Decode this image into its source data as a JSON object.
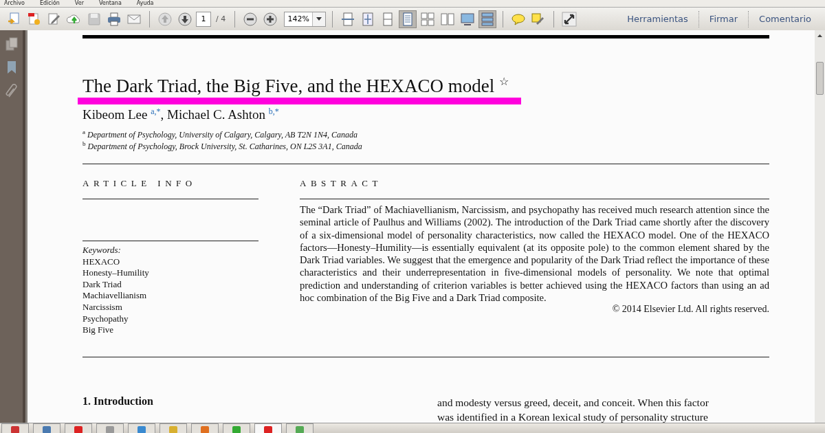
{
  "menu": [
    "Archivo",
    "Edición",
    "Ver",
    "Ventana",
    "Ayuda"
  ],
  "toolbar": {
    "page_field": "1",
    "page_total": "/ 4",
    "zoom": "142%",
    "view_buttons": [
      {
        "selected": false
      },
      {
        "selected": false
      },
      {
        "selected": false
      },
      {
        "selected": true
      },
      {
        "selected": false
      },
      {
        "selected": false
      },
      {
        "selected": false
      },
      {
        "selected": true
      }
    ],
    "panels": [
      "Herramientas",
      "Firmar",
      "Comentario"
    ]
  },
  "document": {
    "title": "The Dark Triad, the Big Five, and the HEXACO model $^{☆}$",
    "authors": "Kibeom Lee $^{a,*}$, Michael C. Ashton $^{b,*}$",
    "affiliations": [
      "$^{a}$ Department of Psychology, University of Calgary, Calgary, AB T2N 1N4, Canada",
      "$^{b}$ Department of Psychology, Brock University, St. Catharines, ON L2S 3A1, Canada"
    ],
    "article_info_heading": "ARTICLE INFO",
    "keywords_label": "Keywords:",
    "keywords": [
      "HEXACO",
      "Honesty–Humility",
      "Dark Triad",
      "Machiavellianism",
      "Narcissism",
      "Psychopathy",
      "Big Five"
    ],
    "abstract_heading": "ABSTRACT",
    "abstract": "The “Dark Triad” of Machiavellianism, Narcissism, and psychopathy has received much research attention since the seminal article of Paulhus and Williams (2002). The introduction of the Dark Triad came shortly after the discovery of a six-dimensional model of personality characteristics, now called the HEXACO model. One of the HEXACO factors—Honesty–Humility—is essentially equivalent (at its opposite pole) to the common element shared by the Dark Triad variables. We suggest that the emergence and popularity of the Dark Triad reflect the importance of these characteristics and their underrepresentation in five-dimensional models of personality. We note that optimal prediction and understanding of criterion variables is better achieved using the HEXACO factors than using an ad hoc combination of the Big Five and a Dark Triad composite.",
    "copyright": "© 2014 Elsevier Ltd. All rights reserved.",
    "section_heading": "1. Introduction",
    "body_lines": [
      "and modesty versus greed, deceit, and conceit. When this factor",
      "was identified in a Korean lexical study of personality structure"
    ]
  }
}
